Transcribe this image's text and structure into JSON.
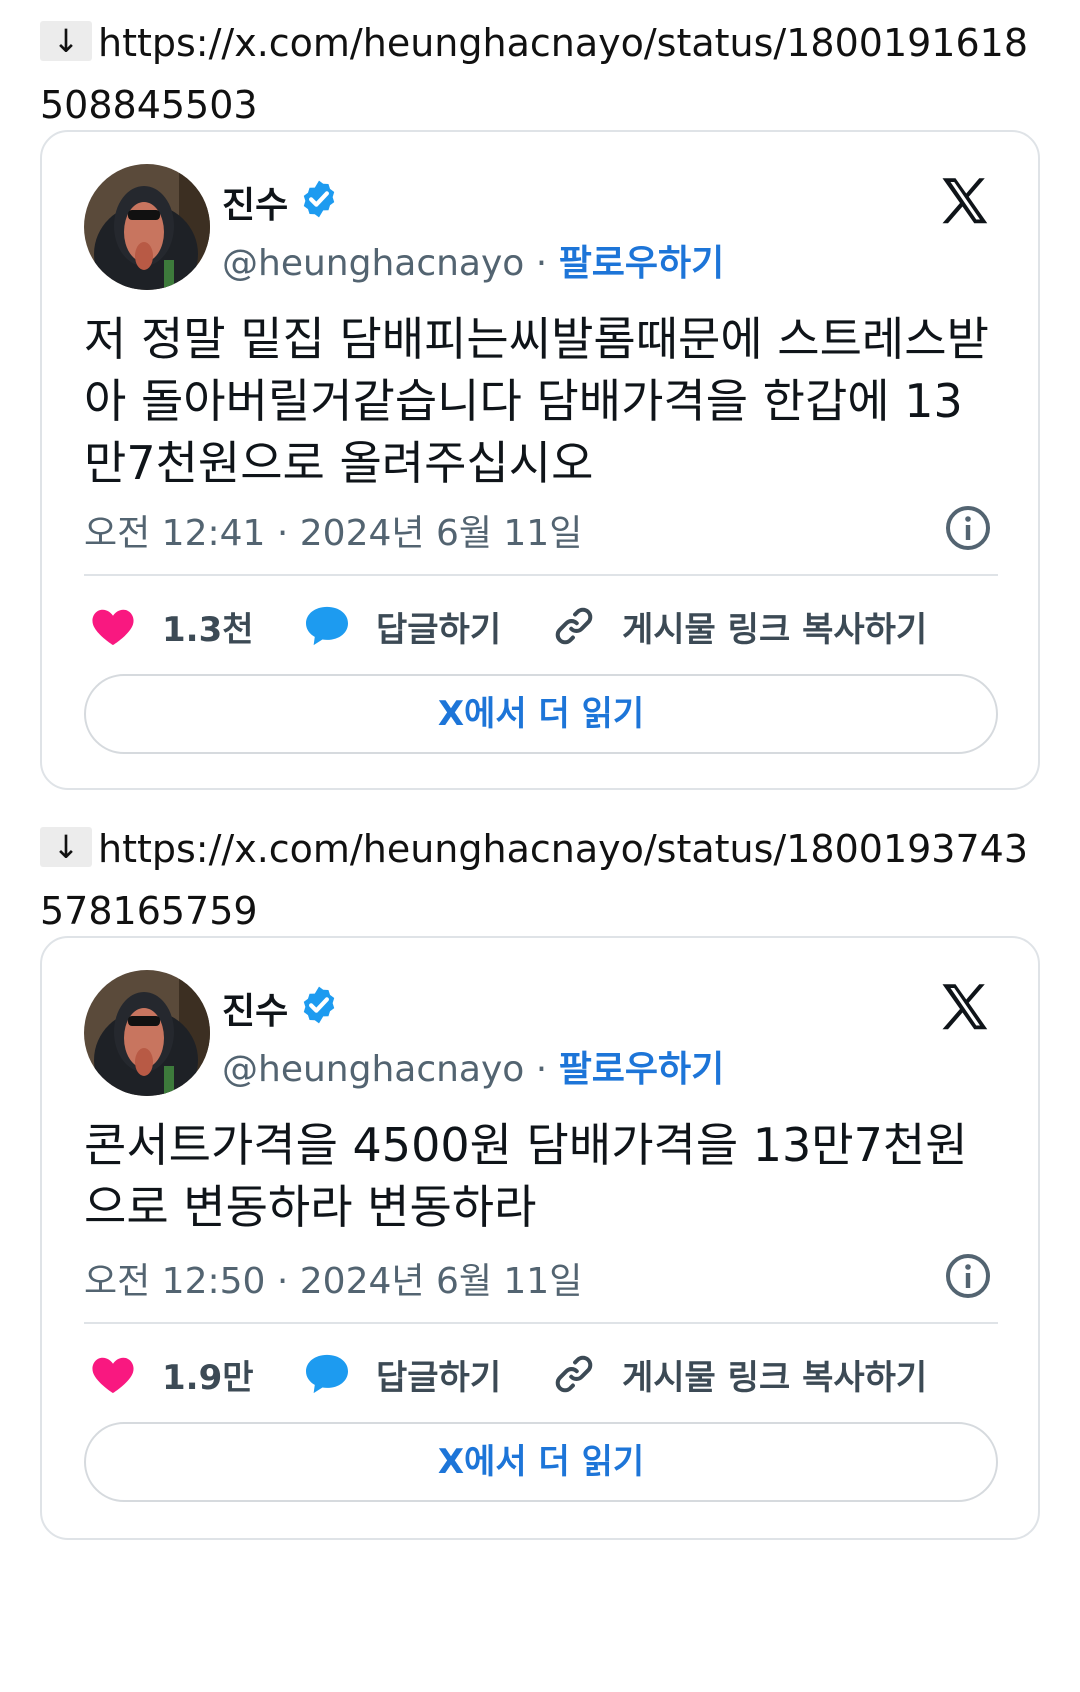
{
  "posts": [
    {
      "link_arrow": "↓",
      "link_url": "https://x.com/heunghacnayo/status/1800191618508845503",
      "author_name": "진수",
      "handle": "@heunghacnayo",
      "separator": "·",
      "follow_label": "팔로우하기",
      "text": "저 정말 밑집 담배피는씨발롬때문에 스트레스받아 돌아버릴거같습니다 담배가격을 한갑에 13만7천원으로 올려주십시오",
      "timestamp": "오전 12:41 · 2024년 6월 11일",
      "likes": "1.3천",
      "reply_label": "답글하기",
      "copy_label": "게시물 링크 복사하기",
      "read_more_label": "X에서 더 읽기"
    },
    {
      "link_arrow": "↓",
      "link_url": "https://x.com/heunghacnayo/status/1800193743578165759",
      "author_name": "진수",
      "handle": "@heunghacnayo",
      "separator": "·",
      "follow_label": "팔로우하기",
      "text": "콘서트가격을 4500원 담배가격을 13만7천원으로 변동하라 변동하라",
      "timestamp": "오전 12:50 · 2024년 6월 11일",
      "likes": "1.9만",
      "reply_label": "답글하기",
      "copy_label": "게시물 링크 복사하기",
      "read_more_label": "X에서 더 읽기"
    }
  ],
  "icons": {
    "like": "heart-icon",
    "reply": "speech-bubble-icon",
    "copy": "link-icon",
    "info": "info-icon",
    "brand": "x-logo-icon",
    "verified": "verified-badge-icon"
  },
  "colors": {
    "like": "#f91880",
    "reply": "#1d9bf0",
    "follow": "#1d75d8",
    "verified": "#1d9bf0",
    "muted": "#536471"
  }
}
